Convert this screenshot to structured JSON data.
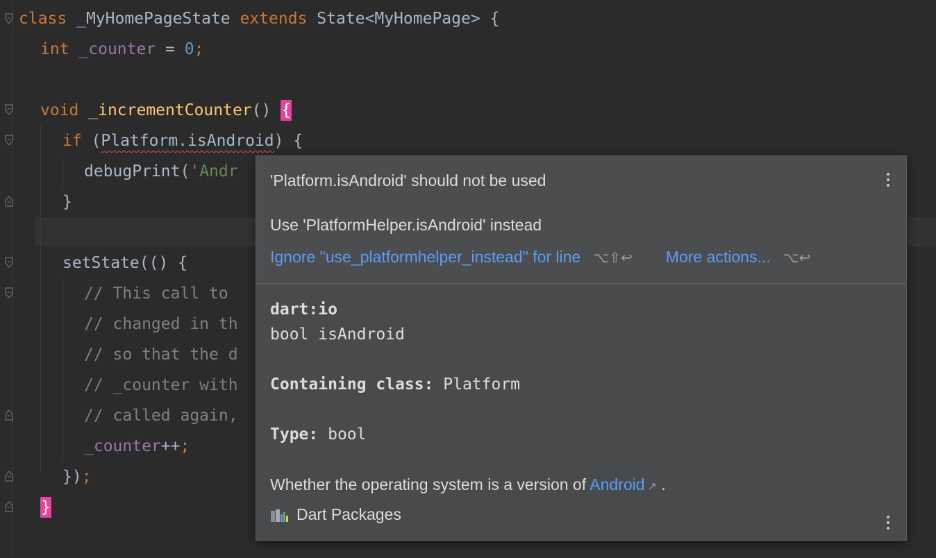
{
  "editor": {
    "lines": {
      "l1": {
        "kw1": "class",
        "name": " _MyHomePageState ",
        "kw2": "extends",
        "rest": " State<MyHomePage> {"
      },
      "l2": {
        "type": "int",
        "field": "_counter",
        "op": " = ",
        "num": "0",
        "semi": ";"
      },
      "l4": {
        "kw": "void",
        "fn": "_incrementCounter",
        "paren": "() ",
        "brace": "{"
      },
      "l5": {
        "kw": "if",
        "open": " (",
        "squiggle": "Platform.isAndroid",
        "close": ") {"
      },
      "l6": {
        "fn": "debugPrint",
        "open": "(",
        "str": "'Andr"
      },
      "l7": {
        "text": "}"
      },
      "l9": {
        "fn": "setState",
        "rest": "(() {"
      },
      "l10": {
        "text": "// This call to"
      },
      "l11": {
        "text": "// changed in th"
      },
      "l12": {
        "text": "// so that the d"
      },
      "l13": {
        "text": "// _counter with"
      },
      "l14": {
        "text": "// called again,"
      },
      "l15": {
        "field": "_counter",
        "op": "++",
        "semi": ";"
      },
      "l16": {
        "text": "})",
        "semi": ";"
      },
      "l17": {
        "brace": "}"
      }
    }
  },
  "popup": {
    "title": "'Platform.isAndroid' should not be used",
    "suggestion": "Use 'PlatformHelper.isAndroid' instead",
    "ignore_action": "Ignore \"use_platformhelper_instead\" for line",
    "ignore_shortcut": "⌥⇧↩",
    "more_actions": "More actions...",
    "more_shortcut": "⌥↩",
    "library": "dart:io",
    "signature": "bool isAndroid",
    "containing_class_label": "Containing class:",
    "containing_class_value": " Platform",
    "type_label": "Type:",
    "type_value": " bool",
    "description": "Whether the operating system is a version of ",
    "description_link": "Android",
    "description_end": " .",
    "source": "Dart Packages"
  },
  "colors": {
    "background": "#2b2b2b",
    "keyword": "#cc7832",
    "field": "#9876aa",
    "number": "#6897bb",
    "function": "#ffc66d",
    "string": "#6a8759",
    "comment": "#808080",
    "brace_highlight": "#e8449a",
    "link": "#589df6",
    "popup_bg": "#4b4d4e"
  }
}
